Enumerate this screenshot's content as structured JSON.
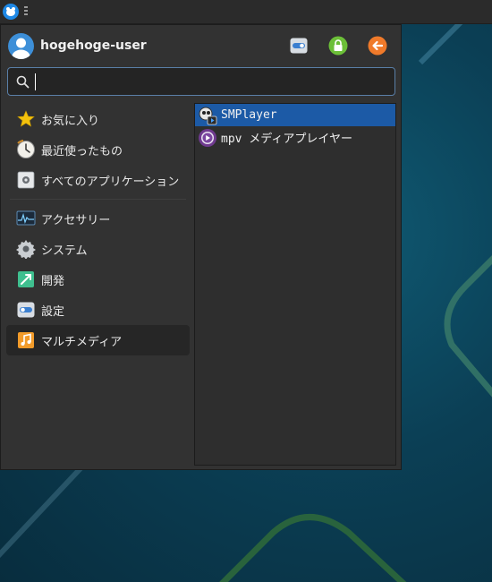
{
  "user": {
    "name": "hogehoge-user"
  },
  "header_buttons": [
    {
      "name": "settings-toggle-button",
      "icon": "toggle-icon"
    },
    {
      "name": "lock-screen-button",
      "icon": "lock-icon"
    },
    {
      "name": "logout-button",
      "icon": "logout-arrow-icon"
    }
  ],
  "search": {
    "value": "",
    "placeholder": ""
  },
  "categories": [
    {
      "label": "お気に入り",
      "icon": "star-icon"
    },
    {
      "label": "最近使ったもの",
      "icon": "clock-icon"
    },
    {
      "label": "すべてのアプリケーション",
      "icon": "all-apps-icon"
    },
    {
      "label": "アクセサリー",
      "icon": "accessories-icon"
    },
    {
      "label": "システム",
      "icon": "system-gear-icon"
    },
    {
      "label": "開発",
      "icon": "development-icon"
    },
    {
      "label": "設定",
      "icon": "settings-icon"
    },
    {
      "label": "マルチメディア",
      "icon": "multimedia-icon",
      "active": true
    }
  ],
  "apps": [
    {
      "label": "SMPlayer",
      "icon": "smplayer-icon",
      "selected": true
    },
    {
      "label": "mpv メディアプレイヤー",
      "icon": "mpv-icon"
    }
  ],
  "colors": {
    "selection": "#1c5aa6",
    "accent_search_border": "#5a7fa7",
    "menu_bg": "#323232"
  }
}
